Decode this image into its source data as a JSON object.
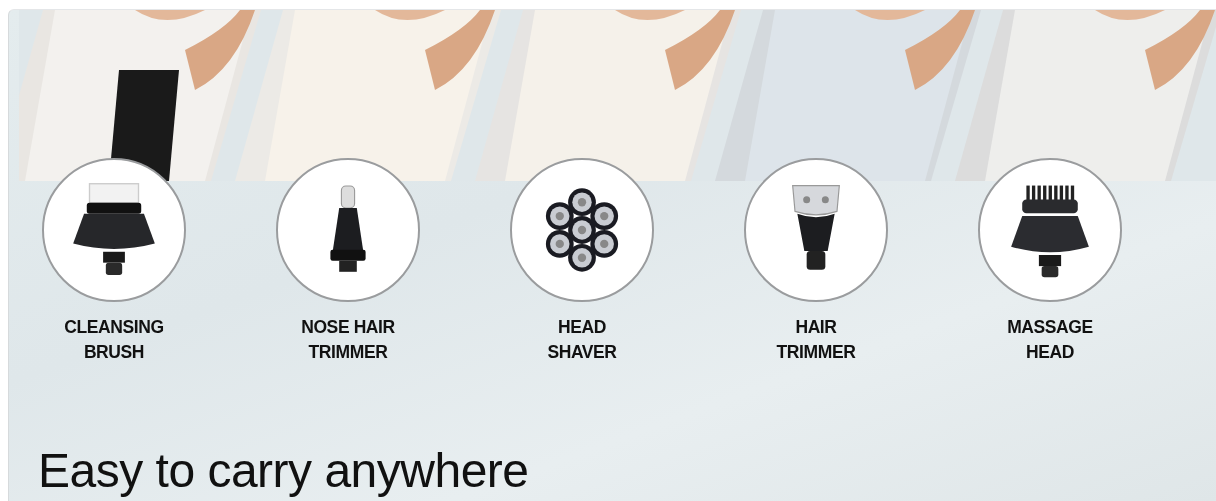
{
  "attachments": [
    {
      "kind": "brush",
      "label_lines": [
        "CLEANSING",
        "BRUSH"
      ]
    },
    {
      "kind": "nose",
      "label_lines": [
        "NOSE HAIR",
        "TRIMMER"
      ]
    },
    {
      "kind": "shaver",
      "label_lines": [
        "HEAD",
        "SHAVER"
      ]
    },
    {
      "kind": "trimmer",
      "label_lines": [
        "HAIR",
        "TRIMMER"
      ]
    },
    {
      "kind": "massage",
      "label_lines": [
        "MASSAGE",
        "HEAD"
      ]
    }
  ],
  "heading": "Easy to carry anywhere"
}
